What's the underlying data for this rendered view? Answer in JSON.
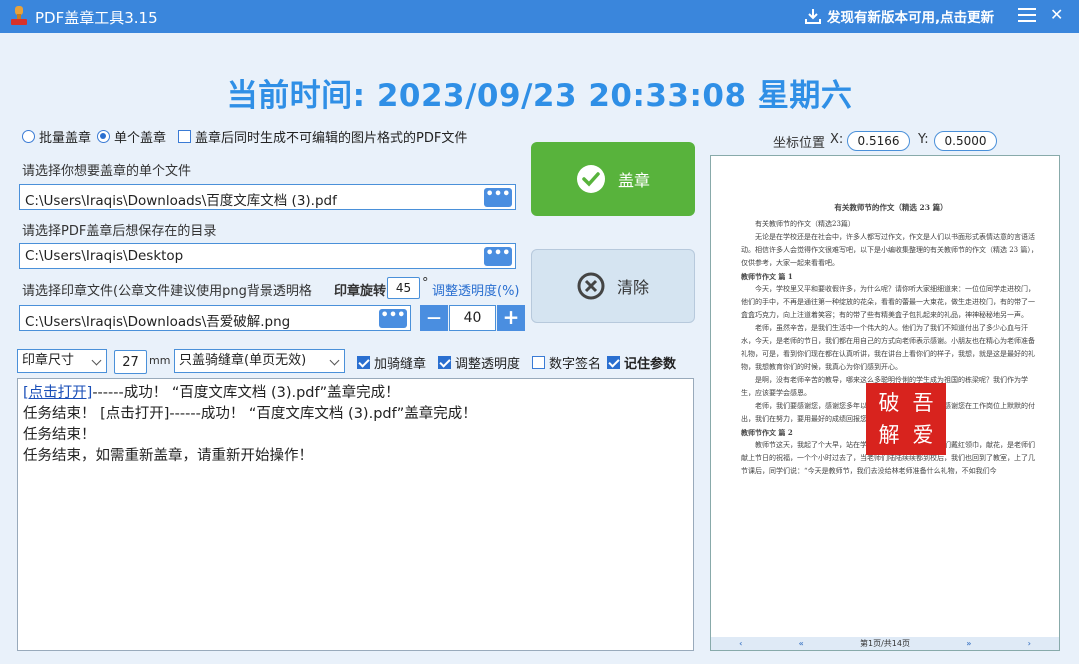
{
  "titlebar": {
    "title": "PDF盖章工具3.15",
    "update_text": "发现有新版本可用,点击更新",
    "close": "✕"
  },
  "clock": "当前时间: 2023/09/23 20:33:08  星期六",
  "options": {
    "batch": "批量盖章",
    "single": "单个盖章",
    "image_pdf": "盖章后同时生成不可编辑的图片格式的PDF文件"
  },
  "file": {
    "label": "请选择你想要盖章的单个文件",
    "value": "C:\\Users\\Iraqis\\Downloads\\百度文库文档 (3).pdf",
    "browse": "•••"
  },
  "outdir": {
    "label": "请选择PDF盖章后想保存在的目录",
    "value": "C:\\Users\\Iraqis\\Desktop",
    "browse": "•••"
  },
  "stampfile": {
    "label": "请选择印章文件(公章文件建议使用png背景透明格",
    "rotate_label": "印章旋转",
    "rotate_value": "45",
    "rotate_unit": "°",
    "opacity_label": "调整透明度(%)",
    "value": "C:\\Users\\Iraqis\\Downloads\\吾爱破解.png",
    "browse": "•••",
    "minus": "—",
    "opacity_value": "40",
    "plus": "+"
  },
  "buttons": {
    "stamp": "盖章",
    "clear": "清除"
  },
  "settings": {
    "size_select": "印章尺寸",
    "size_value": "27",
    "size_unit": "mm",
    "mode_select": "只盖骑缝章(单页无效)",
    "seam": "加骑缝章",
    "opacity": "调整透明度",
    "digital_sign": "数字签名",
    "remember": "记住参数"
  },
  "log": {
    "line1_link": "[点击打开]",
    "line1_rest": "------成功！ “百度文库文档 (3).pdf”盖章完成！",
    "line2": "任务结束！ [点击打开]------成功！ “百度文库文档 (3).pdf”盖章完成！",
    "line3": "任务结束！",
    "line4": "任务结束，如需重新盖章，请重新开始操作！"
  },
  "coords": {
    "label": "坐标位置",
    "x_label": "X:",
    "x_value": "0.5166",
    "y_label": "Y:",
    "y_value": "0.5000"
  },
  "preview": {
    "doc_title": "有关教师节的作文（精选 23 篇）",
    "sub": "有关教师节的作文（精选23篇）",
    "p1": "无论是在学校还是在社会中，许多人都写过作文，作文是人们以书面形式表情达意的言语活动。相信许多人会觉得作文很难写吧，以下是小编收集整理的有关教师节的作文（精选 23 篇），仅供参考，大家一起来看看吧。",
    "h1": "教师节作文 篇 1",
    "p2": "今天，学校里又平和要收假许多，为什么呢？请你听大家细细道来：一位位同学走进校门，他们的手中，不再是通往第一种绽放的花朵，看看的蕾最一大束花，做生走进校门，有的带了一盒盒巧克力，向上注道着笑容；有的带了些有精美盒子包扎起来的礼品，神神秘秘地另一声。",
    "p3": "老师，虽然辛苦，是我们生活中一个伟大的人。他们为了我们不知道付出了多少心血与汗水，今天，是老师的节日，我们都在用自己的方式向老师表示感谢。小朋友也在精心为老师准备礼物，可是，看到你们现在都在认真听讲，我在讲台上看你们的样子，我想，就是这是最好的礼物，我想教育你们的时候，我真心为你们感到开心。",
    "p4": "是啊，没有老师辛苦的教导，哪来这么多聪明伶俐的学生成为祖国的栋梁呢？我们作为学生，应该要学会感恩。",
    "p5": "老师，我们要感谢您，感谢您多年以来对我们的关爱和照顾，感谢您在工作岗位上默默的付出，我们在努力，要用最好的成绩回报您！",
    "h2": "教师节作文 篇 2",
    "p6": "教师节这天，我起了个大早，站在学校的门口，他来我的老师们戴红领巾，献花，是老师们献上节日的祝福，一个个小时过去了，当老师们陆陆续续都到校后，我们也回到了教室，上了几节课后，同学们说：“今天是教师节，我们去没给林老师准备什么礼物，不如我们今",
    "seal": [
      "吾",
      "爱",
      "破",
      "解"
    ],
    "pager": {
      "first": "‹",
      "prev": "«",
      "page": "第1页/共14页",
      "next": "»",
      "last": "›"
    }
  },
  "colors": {
    "titlebar": "#3a86dc",
    "clock": "#2f8fe6",
    "stamp_button": "#58b33c",
    "seal": "#d8231e"
  }
}
